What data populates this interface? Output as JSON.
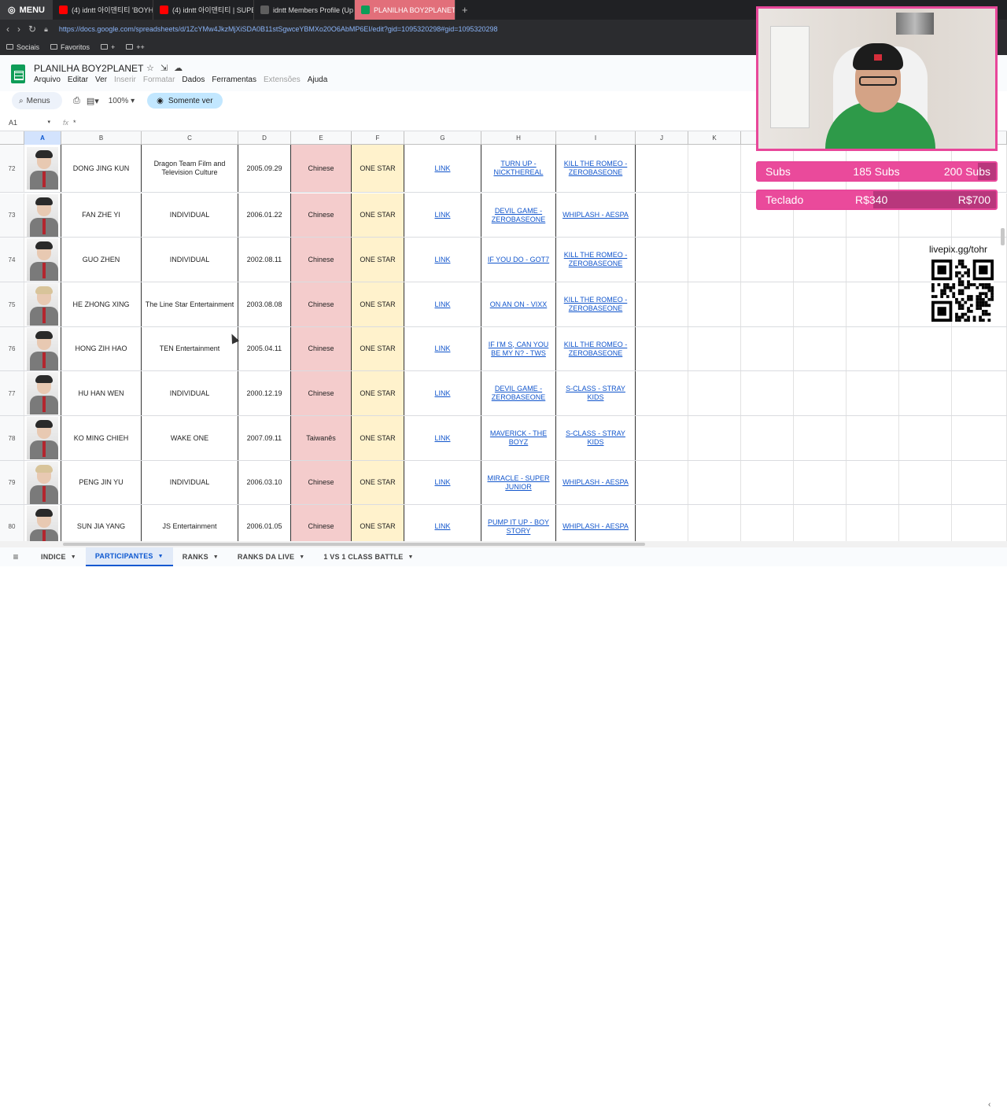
{
  "browser": {
    "menu_label": "MENU",
    "tabs": [
      {
        "label": "(4) idntt 아이덴티티 'BOYHOO",
        "icon": "youtube-icon"
      },
      {
        "label": "(4) idntt 아이덴티티 | SUPER",
        "icon": "youtube-icon"
      },
      {
        "label": "idntt Members Profile (Up",
        "icon": "kpop-profile-icon"
      },
      {
        "label": "PLANILHA BOY2PLANET",
        "icon": "sheets-icon"
      }
    ],
    "url": "https://docs.google.com/spreadsheets/d/1ZcYMw4JkzMjXiSDA0B11stSgwceYBMXo20O6AbMP6EI/edit?gid=1095320298#gid=1095320298",
    "bookmarks": [
      "Sociais",
      "Favoritos",
      "+",
      "++"
    ]
  },
  "doc": {
    "title": "PLANILHA BOY2PLANET",
    "menus": [
      {
        "label": "Arquivo",
        "enabled": true
      },
      {
        "label": "Editar",
        "enabled": true
      },
      {
        "label": "Ver",
        "enabled": true
      },
      {
        "label": "Inserir",
        "enabled": false
      },
      {
        "label": "Formatar",
        "enabled": false
      },
      {
        "label": "Dados",
        "enabled": true
      },
      {
        "label": "Ferramentas",
        "enabled": true
      },
      {
        "label": "Extensões",
        "enabled": false
      },
      {
        "label": "Ajuda",
        "enabled": true
      }
    ]
  },
  "toolbar": {
    "search_label": "Menus",
    "zoom": "100%",
    "view_only_label": "Somente ver"
  },
  "formula_bar": {
    "cell_ref": "A1",
    "formula": "*"
  },
  "columns": [
    "A",
    "B",
    "C",
    "D",
    "E",
    "F",
    "G",
    "H",
    "I",
    "J",
    "K"
  ],
  "rows": [
    {
      "num": "72",
      "name": "DONG JING KUN",
      "agency": "Dragon Team Film and Television Culture",
      "birth": "2005.09.29",
      "nationality": "Chinese",
      "rank": "ONE STAR",
      "link": "LINK",
      "song1": "TURN UP - NICKTHEREAL",
      "song2": "KILL THE ROMEO - ZEROBASEONE",
      "hair": "dark"
    },
    {
      "num": "73",
      "name": "FAN ZHE YI",
      "agency": "INDIVIDUAL",
      "birth": "2006.01.22",
      "nationality": "Chinese",
      "rank": "ONE STAR",
      "link": "LINK",
      "song1": "DEVIL GAME - ZEROBASEONE",
      "song2": "WHIPLASH - AESPA",
      "hair": "dark"
    },
    {
      "num": "74",
      "name": "GUO ZHEN",
      "agency": "INDIVIDUAL",
      "birth": "2002.08.11",
      "nationality": "Chinese",
      "rank": "ONE STAR",
      "link": "LINK",
      "song1": "IF YOU DO - GOT7",
      "song2": "KILL THE ROMEO - ZEROBASEONE",
      "hair": "dark"
    },
    {
      "num": "75",
      "name": "HE ZHONG XING",
      "agency": "The Line Star Entertainment",
      "birth": "2003.08.08",
      "nationality": "Chinese",
      "rank": "ONE STAR",
      "link": "LINK",
      "song1": "ON AN ON - VIXX",
      "song2": "KILL THE ROMEO - ZEROBASEONE",
      "hair": "light"
    },
    {
      "num": "76",
      "name": "HONG ZIH HAO",
      "agency": "TEN Entertainment",
      "birth": "2005.04.11",
      "nationality": "Chinese",
      "rank": "ONE STAR",
      "link": "LINK",
      "song1": "IF I'M S, CAN YOU BE MY N? - TWS",
      "song2": "KILL THE ROMEO - ZEROBASEONE",
      "hair": "dark"
    },
    {
      "num": "77",
      "name": "HU HAN WEN",
      "agency": "INDIVIDUAL",
      "birth": "2000.12.19",
      "nationality": "Chinese",
      "rank": "ONE STAR",
      "link": "LINK",
      "song1": "DEVIL GAME - ZEROBASEONE",
      "song2": "S-CLASS - STRAY KIDS",
      "hair": "dark"
    },
    {
      "num": "78",
      "name": "KO MING CHIEH",
      "agency": "WAKE ONE",
      "birth": "2007.09.11",
      "nationality": "Taiwanês",
      "rank": "ONE STAR",
      "link": "LINK",
      "song1": "MAVERICK - THE BOYZ",
      "song2": "S-CLASS - STRAY KIDS",
      "hair": "dark"
    },
    {
      "num": "79",
      "name": "PENG JIN YU",
      "agency": "INDIVIDUAL",
      "birth": "2006.03.10",
      "nationality": "Chinese",
      "rank": "ONE STAR",
      "link": "LINK",
      "song1": "MIRACLE - SUPER JUNIOR",
      "song2": "WHIPLASH - AESPA",
      "hair": "light"
    },
    {
      "num": "80",
      "name": "SUN JIA YANG",
      "agency": "JS Entertainment",
      "birth": "2006.01.05",
      "nationality": "Chinese",
      "rank": "ONE STAR",
      "link": "LINK",
      "song1": "PUMP IT UP - BOY STORY",
      "song2": "WHIPLASH - AESPA",
      "hair": "dark"
    }
  ],
  "sheet_tabs": [
    {
      "label": "INDICE",
      "active": false
    },
    {
      "label": "PARTICIPANTES",
      "active": true
    },
    {
      "label": "RANKS",
      "active": false
    },
    {
      "label": "RANKS DA LIVE",
      "active": false
    },
    {
      "label": "1 VS 1 CLASS BATTLE",
      "active": false
    }
  ],
  "overlay": {
    "subs": {
      "label": "Subs",
      "current": "185 Subs",
      "goal": "200 Subs",
      "progress": 0.925
    },
    "keyboard": {
      "label": "Teclado",
      "current": "R$340",
      "goal": "R$700",
      "progress": 0.486
    },
    "livepix": "livepix.gg/tohr",
    "accent": "#e8479a"
  }
}
